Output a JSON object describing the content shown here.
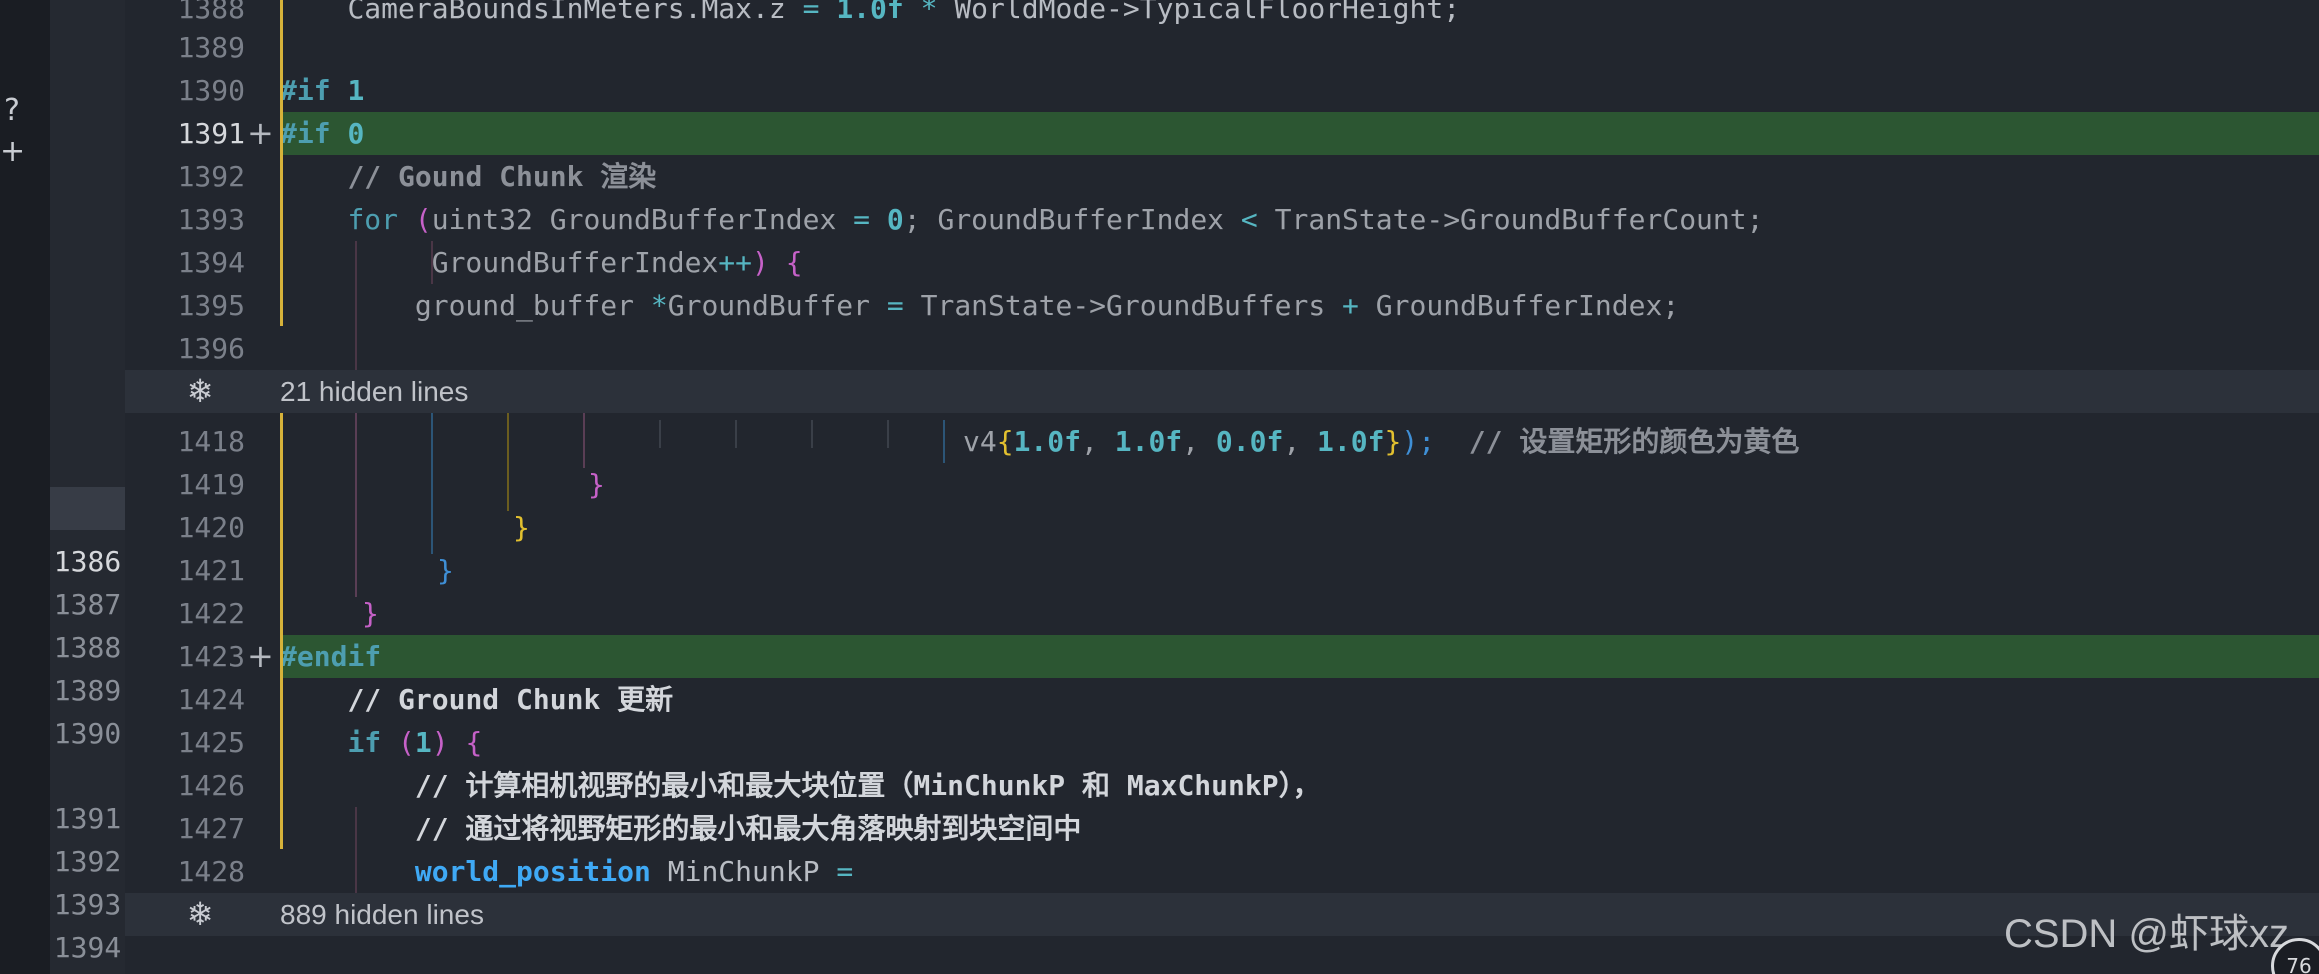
{
  "left_strip": {
    "glyphs": [
      "?",
      "+"
    ]
  },
  "old_gutter": {
    "lines": [
      "1386",
      "1387",
      "1388",
      "1389",
      "1390",
      "1391",
      "1392",
      "1393",
      "1394"
    ]
  },
  "diff": {
    "line_numbers": {
      "n1388": "1388",
      "n1389": "1389",
      "n1390": "1390",
      "n1391": "1391",
      "n1392": "1392",
      "n1393": "1393",
      "n1394": "1394",
      "n1395": "1395",
      "n1396": "1396",
      "n1418": "1418",
      "n1419": "1419",
      "n1420": "1420",
      "n1421": "1421",
      "n1422": "1422",
      "n1423": "1423",
      "n1424": "1424",
      "n1425": "1425",
      "n1426": "1426",
      "n1427": "1427",
      "n1428": "1428"
    },
    "added_marker": "+",
    "code": {
      "l1388": {
        "a": "CameraBoundsInMeters.Max.z ",
        "b": "= ",
        "c": "1.0f ",
        "d": "* ",
        "e": "WorldMode->TypicalFloorHeight;"
      },
      "l1390": {
        "kw": "#if ",
        "num": "1"
      },
      "l1391": {
        "kw": "#if ",
        "num": "0"
      },
      "l1392": {
        "text": "// Gound Chunk 渲染"
      },
      "l1393": {
        "kw": "for ",
        "p1": "(",
        "a": "uint32 GroundBufferIndex ",
        "op1": "= ",
        "num": "0",
        "b": "; GroundBufferIndex ",
        "op2": "< ",
        "c": "TranState->GroundBufferCount;"
      },
      "l1394": {
        "a": "GroundBufferIndex",
        "op": "++",
        "p1": ") ",
        "p2": "{"
      },
      "l1395": {
        "a": "ground_buffer ",
        "op1": "*",
        "b": "GroundBuffer ",
        "op2": "= ",
        "c": "TranState->GroundBuffers ",
        "op3": "+ ",
        "d": "GroundBufferIndex;"
      },
      "l1418": {
        "a": "v4",
        "p1": "{",
        "n1": "1.0f",
        "s1": ", ",
        "n2": "1.0f",
        "s2": ", ",
        "n3": "0.0f",
        "s3": ", ",
        "n4": "1.0f",
        "p2": "}",
        "p3": ");  ",
        "cmt": "// 设置矩形的颜色为黄色"
      },
      "l1419": {
        "p": "}"
      },
      "l1420": {
        "p": "}"
      },
      "l1421": {
        "p": "}"
      },
      "l1422": {
        "p": "}"
      },
      "l1423": {
        "kw": "#endif"
      },
      "l1424": {
        "text": "// Ground Chunk 更新"
      },
      "l1425": {
        "kw": "if ",
        "p1": "(",
        "num": "1",
        "p2": ") ",
        "p3": "{"
      },
      "l1426": {
        "text": "// 计算相机视野的最小和最大块位置（MinChunkP 和 MaxChunkP），"
      },
      "l1427": {
        "text": "// 通过将视野矩形的最小和最大角落映射到块空间中"
      },
      "l1428": {
        "type": "world_position",
        "a": " MinChunkP ",
        "op": "="
      }
    },
    "folds": [
      {
        "label": "21 hidden lines",
        "icon": "unfold-icon"
      },
      {
        "label": "889 hidden lines",
        "icon": "unfold-icon"
      }
    ]
  },
  "watermark": "CSDN @虾球xz",
  "badge": "76",
  "colors": {
    "background": "#22262e",
    "added_line": "#2c5632",
    "change_bar": "#d6b23a",
    "keyword": "#4d9eb0",
    "type": "#3fa9f5"
  }
}
